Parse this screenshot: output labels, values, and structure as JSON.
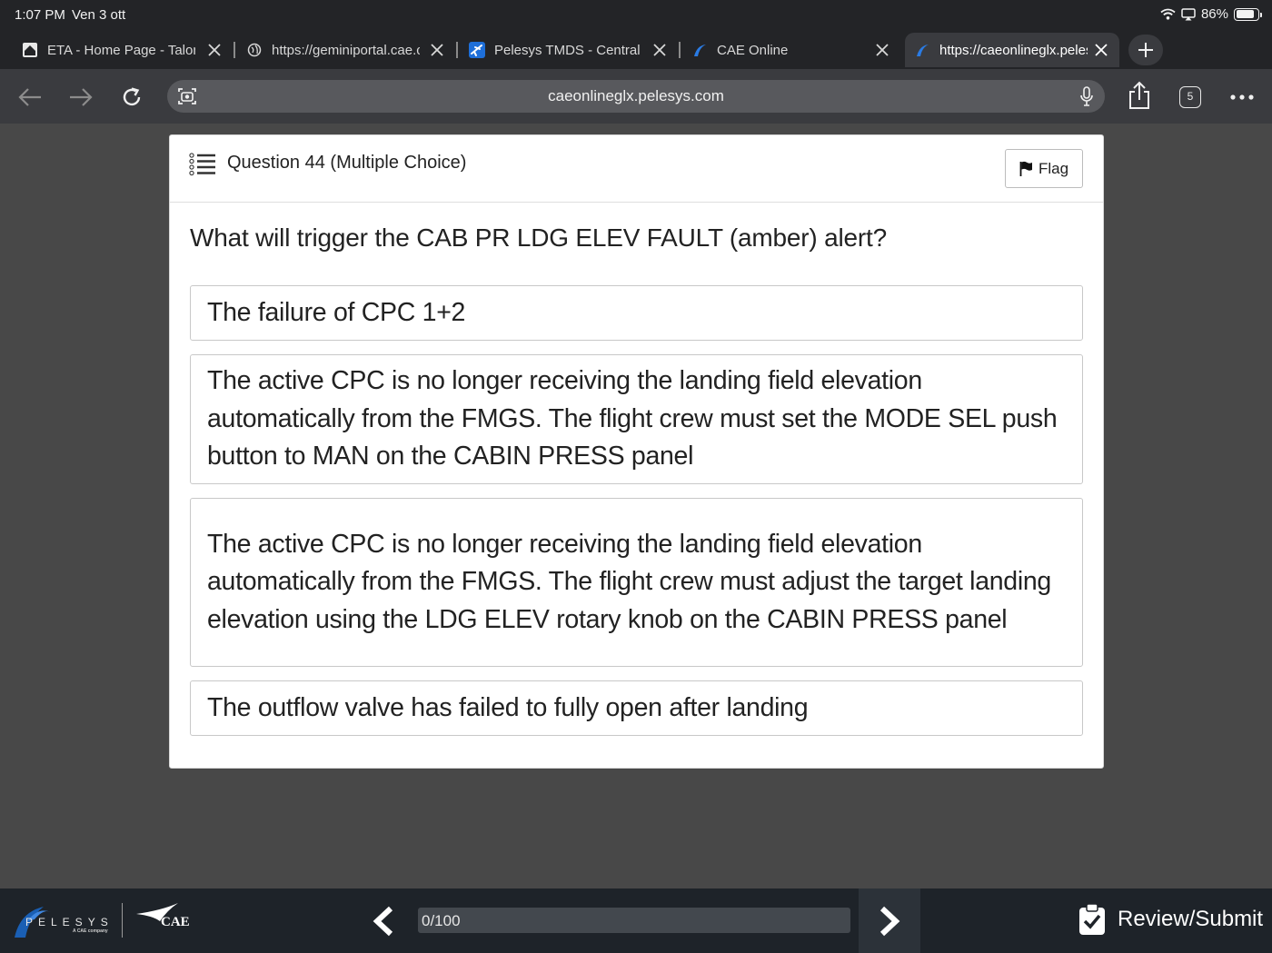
{
  "status_bar": {
    "time": "1:07 PM",
    "date": "Ven 3 ott",
    "battery": "86%",
    "battery_level": 0.86
  },
  "tabs": [
    {
      "title": "ETA - Home Page - Talon",
      "icon": "home-favicon-icon"
    },
    {
      "title": "https://geminiportal.cae.com",
      "icon": "globe-icon"
    },
    {
      "title": "Pelesys TMDS - Central",
      "icon": "airplane-favicon-icon"
    },
    {
      "title": "CAE Online",
      "icon": "pelesys-favicon-icon"
    },
    {
      "title": "https://caeonlineglx.pelesys.com",
      "icon": "pelesys-favicon-icon",
      "active": true
    }
  ],
  "toolbar": {
    "url": "caeonlineglx.pelesys.com",
    "tab_count": "5"
  },
  "question": {
    "label": "Question 44 (Multiple Choice)",
    "flag_label": "Flag",
    "text": "What will trigger the CAB PR LDG ELEV FAULT (amber) alert?",
    "options": [
      "The failure of CPC 1+2",
      "The active CPC is no longer receiving the landing field elevation automatically from the FMGS. The flight crew must set the MODE SEL push button to MAN on the CABIN PRESS panel",
      "The active CPC is no longer receiving the landing field elevation automatically from the FMGS. The flight crew must adjust the target landing elevation using the LDG ELEV rotary knob on the CABIN PRESS panel",
      "The outflow valve has failed to fully open after landing"
    ]
  },
  "footer": {
    "brand": "PELESYS",
    "brand_sub": "A CAE company",
    "partner": "CAE",
    "progress_text": "0/100",
    "progress_fraction": 0,
    "review_label": "Review/Submit"
  },
  "colors": {
    "chrome_bg": "#232427",
    "toolbar_bg": "#3a3b3f",
    "page_bg": "#484848",
    "footer_bg": "#1e2329",
    "pelesys_blue": "#1a5fb4"
  }
}
